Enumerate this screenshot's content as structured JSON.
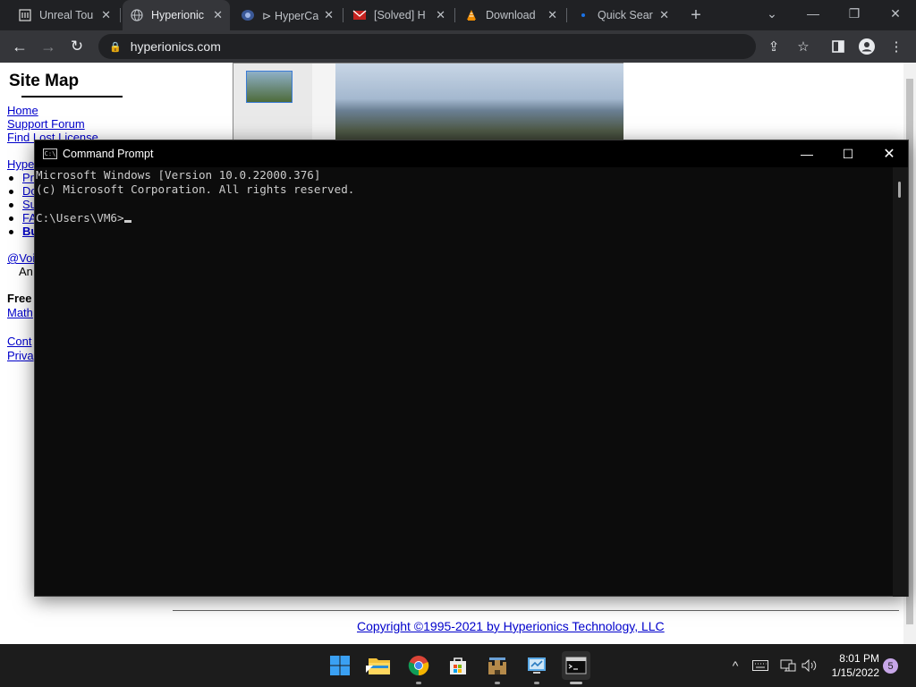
{
  "browser": {
    "tabs": [
      {
        "title": "Unreal Tou",
        "icon": "unreal-icon"
      },
      {
        "title": "Hyperionic",
        "icon": "globe-icon"
      },
      {
        "title": "⊳ HyperCa",
        "icon": "hypercam-icon"
      },
      {
        "title": "[Solved] H",
        "icon": "gmail-icon"
      },
      {
        "title": "Download",
        "icon": "vlc-icon"
      },
      {
        "title": "Quick Sear",
        "icon": "search-icon"
      }
    ],
    "url": "hyperionics.com"
  },
  "page": {
    "sitemap_title": "Site Map",
    "links": {
      "home": "Home",
      "support_forum": "Support Forum",
      "find_lost_license": "Find Lost License",
      "hype": "Hype",
      "pr": "Pr",
      "do": "Do",
      "su": "Su",
      "faq": "FAC",
      "bu": "Bu",
      "voi": "@Voi",
      "math": "Math",
      "cont": "Cont",
      "priva": "Priva"
    },
    "texts": {
      "an": "An",
      "free": "Free"
    },
    "copyright": "Copyright ©1995-2021 by Hyperionics Technology, LLC"
  },
  "cmd": {
    "title": "Command Prompt",
    "lines": [
      "Microsoft Windows [Version 10.0.22000.376]",
      "(c) Microsoft Corporation. All rights reserved.",
      "",
      "C:\\Users\\VM6>"
    ]
  },
  "taskbar": {
    "time": "8:01 PM",
    "date": "1/15/2022",
    "notification_count": "5"
  }
}
